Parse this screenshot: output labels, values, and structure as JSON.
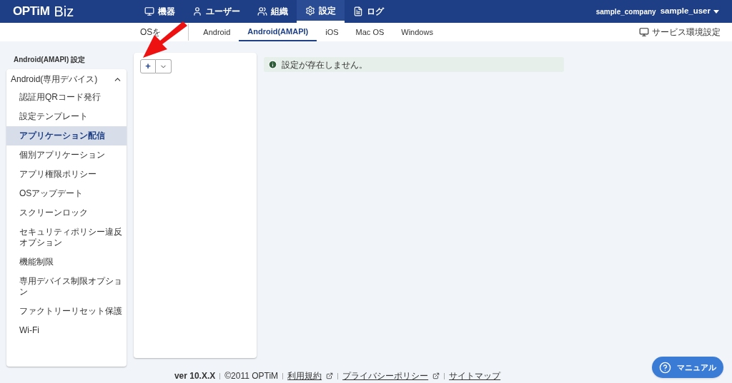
{
  "header": {
    "logo": "OPTiM",
    "logo_suffix": "Biz",
    "nav": [
      {
        "label": "機器",
        "selected": false
      },
      {
        "label": "ユーザー",
        "selected": false
      },
      {
        "label": "組織",
        "selected": false
      },
      {
        "label": "設定",
        "selected": true
      },
      {
        "label": "ログ",
        "selected": false
      }
    ],
    "company": "sample_company",
    "user": "sample_user"
  },
  "os_tabs": {
    "label": "OSを",
    "tabs": [
      {
        "label": "Android",
        "selected": false
      },
      {
        "label": "Android(AMAPI)",
        "selected": true
      },
      {
        "label": "iOS",
        "selected": false
      },
      {
        "label": "Mac OS",
        "selected": false
      },
      {
        "label": "Windows",
        "selected": false
      }
    ],
    "service_settings": "サービス環境設定"
  },
  "sidebar": {
    "title": "Android(AMAPI) 設定",
    "group": {
      "label": "Android(専用デバイス)",
      "expanded": true,
      "items": [
        {
          "label": "認証用QRコード発行",
          "selected": false
        },
        {
          "label": "設定テンプレート",
          "selected": false
        },
        {
          "label": "アプリケーション配信",
          "selected": true
        },
        {
          "label": "個別アプリケーション",
          "selected": false
        },
        {
          "label": "アプリ権限ポリシー",
          "selected": false
        },
        {
          "label": "OSアップデート",
          "selected": false
        },
        {
          "label": "スクリーンロック",
          "selected": false
        },
        {
          "label": "セキュリティポリシー違反オプション",
          "selected": false
        },
        {
          "label": "機能制限",
          "selected": false
        },
        {
          "label": "専用デバイス制限オプション",
          "selected": false
        },
        {
          "label": "ファクトリーリセット保護",
          "selected": false
        },
        {
          "label": "Wi-Fi",
          "selected": false
        }
      ]
    }
  },
  "toolbar": {
    "add": "+"
  },
  "alert": {
    "message": "設定が存在しません。"
  },
  "footer": {
    "version": "ver 10.X.X",
    "copyright": "©2011 OPTiM",
    "links": [
      {
        "label": "利用規約",
        "external": true
      },
      {
        "label": "プライバシーポリシー",
        "external": true
      },
      {
        "label": "サイトマップ",
        "external": false
      }
    ]
  },
  "manual_button": "マニュアル"
}
